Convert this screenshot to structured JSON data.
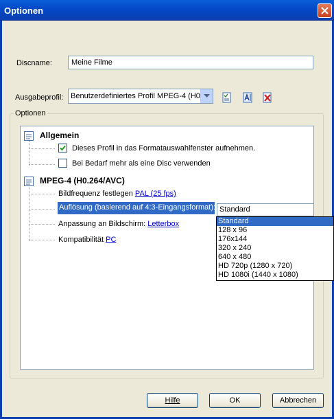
{
  "window": {
    "title": "Optionen"
  },
  "discname": {
    "label": "Discname:",
    "value": "Meine Filme"
  },
  "ausgabeprofil": {
    "label": "Ausgabeprofil:",
    "value": "Benutzerdefiniertes Profil MPEG-4 (H0."
  },
  "toolbar_icons": [
    "edit-profile-icon",
    "rename-profile-icon",
    "delete-profile-icon"
  ],
  "group": {
    "label": "Optionen"
  },
  "sections": {
    "allgemein": {
      "title": "Allgemein",
      "options": [
        {
          "label": "Dieses Profil in das Formatauswahlfenster aufnehmen.",
          "checked": true
        },
        {
          "label": "Bei Bedarf mehr als eine Disc verwenden",
          "checked": false
        }
      ]
    },
    "mpeg4": {
      "title": "MPEG-4 (H0.264/AVC)",
      "framerate": {
        "label": "Bildfrequenz festlegen",
        "link": "PAL (25 fps)"
      },
      "resolution": {
        "label": "Auflösung (basierend auf 4:3-Eingangsformat):",
        "value": "Standard"
      },
      "fit": {
        "label": "Anpassung an Bildschirm:",
        "link": "Letterbox"
      },
      "compat": {
        "label": "Kompatibilität",
        "link": "PC"
      }
    }
  },
  "dropdown": {
    "options": [
      "Standard",
      "128 x 96",
      "176x144",
      "320 x 240",
      "640 x 480",
      "HD 720p  (1280 x 720)",
      "HD 1080i  (1440 x 1080)"
    ],
    "selected": "Standard"
  },
  "buttons": {
    "help": "Hilfe",
    "ok": "OK",
    "cancel": "Abbrechen"
  },
  "colors": {
    "titlebar": "#0a5fd8",
    "selection": "#316ac5",
    "dialog_bg": "#ece9d8",
    "link": "#0000cc"
  }
}
